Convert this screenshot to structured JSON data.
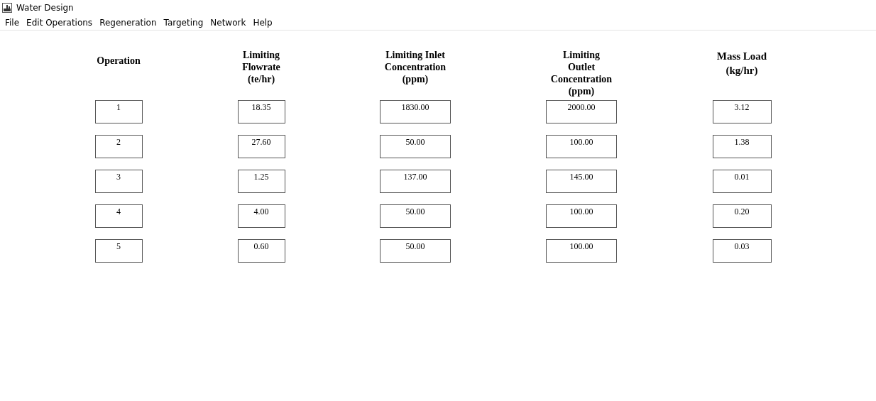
{
  "window": {
    "title": "Water Design"
  },
  "menu": [
    "File",
    "Edit Operations",
    "Regeneration",
    "Targeting",
    "Network",
    "Help"
  ],
  "table": {
    "columns": [
      "Operation",
      "Limiting\nFlowrate\n(te/hr)",
      "Limiting Inlet\nConcentration\n(ppm)",
      "Limiting\nOutlet\nConcentration\n(ppm)",
      "Mass Load\n(kg/hr)"
    ],
    "rows": [
      [
        "1",
        "18.35",
        "1830.00",
        "2000.00",
        "3.12"
      ],
      [
        "2",
        "27.60",
        "50.00",
        "100.00",
        "1.38"
      ],
      [
        "3",
        "1.25",
        "137.00",
        "145.00",
        "0.01"
      ],
      [
        "4",
        "4.00",
        "50.00",
        "100.00",
        "0.20"
      ],
      [
        "5",
        "0.60",
        "50.00",
        "100.00",
        "0.03"
      ]
    ]
  }
}
